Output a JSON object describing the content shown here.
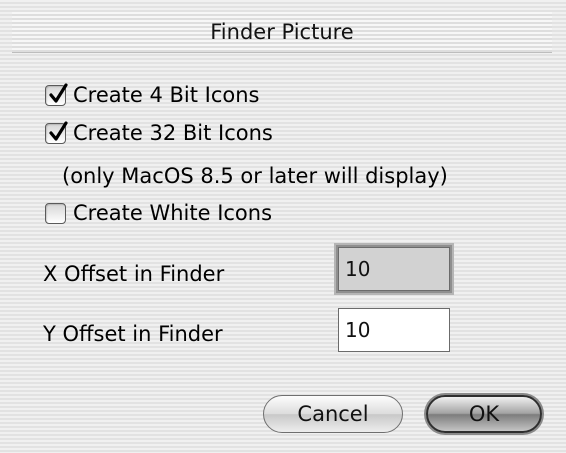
{
  "dialog": {
    "title": "Finder Picture"
  },
  "options": [
    {
      "label": "Create 4 Bit Icons",
      "checked": true
    },
    {
      "label": "Create 32 Bit Icons",
      "checked": true
    },
    {
      "label": "Create White Icons",
      "checked": false
    }
  ],
  "note": "(only MacOS 8.5 or later will display)",
  "fields": {
    "x_offset": {
      "label": "X Offset in Finder",
      "value": "10",
      "focused": true
    },
    "y_offset": {
      "label": "Y Offset in Finder",
      "value": "10",
      "focused": false
    }
  },
  "buttons": {
    "cancel_label": "Cancel",
    "ok_label": "OK"
  },
  "icons": {
    "checkmark": "checkmark-icon"
  }
}
